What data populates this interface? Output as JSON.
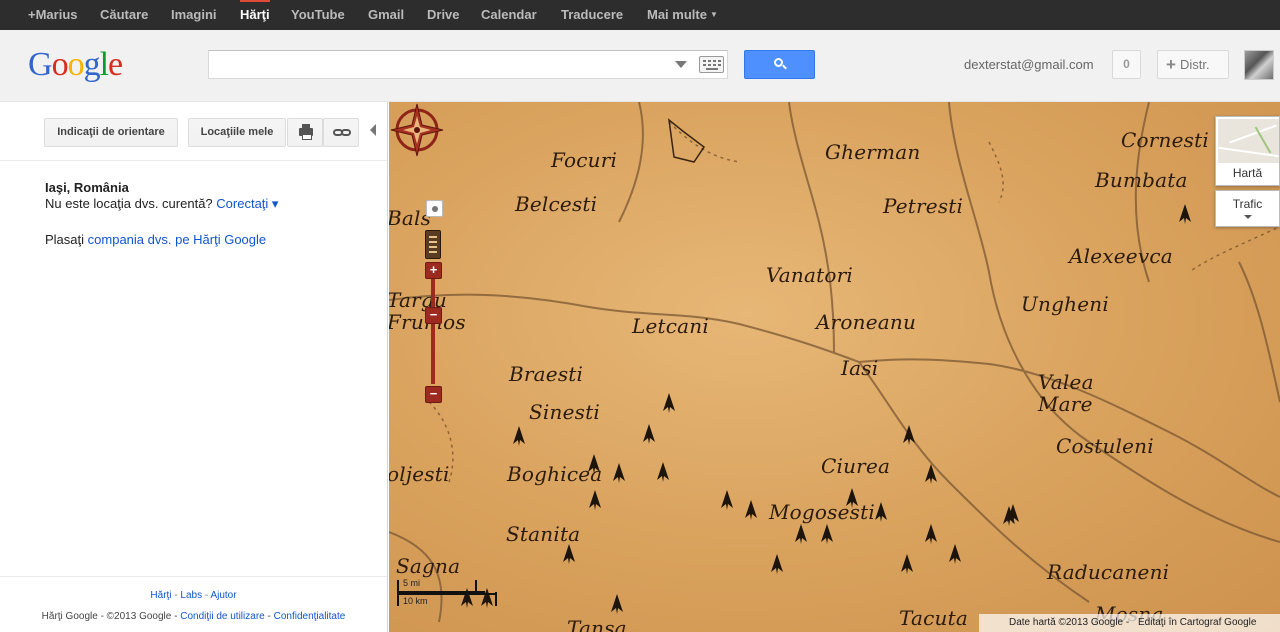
{
  "top_nav": {
    "items": [
      {
        "label": "+Marius",
        "active": false
      },
      {
        "label": "Căutare",
        "active": false
      },
      {
        "label": "Imagini",
        "active": false
      },
      {
        "label": "Hărţi",
        "active": true
      },
      {
        "label": "YouTube",
        "active": false
      },
      {
        "label": "Gmail",
        "active": false
      },
      {
        "label": "Drive",
        "active": false
      },
      {
        "label": "Calendar",
        "active": false
      },
      {
        "label": "Traducere",
        "active": false
      }
    ],
    "more_label": "Mai multe"
  },
  "header": {
    "logo_letters": [
      "G",
      "o",
      "o",
      "g",
      "l",
      "e"
    ],
    "logo_colors": [
      "#3366cc",
      "#d62d20",
      "#f4b400",
      "#3366cc",
      "#069e2d",
      "#d62d20"
    ],
    "search": {
      "value": "",
      "placeholder": ""
    },
    "account_email": "dexterstat@gmail.com",
    "notification_count": "0",
    "share_label": "Distr."
  },
  "panel": {
    "toolbar": {
      "directions_label": "Indicaţii de orientare",
      "my_places_label": "Locaţiile mele",
      "print_icon": "printer-icon",
      "link_icon": "link-icon"
    },
    "location": {
      "title": "Iaşi, România",
      "question": "Nu este locaţia dvs. curentă?",
      "correct_link": "Corectaţi ▾"
    },
    "place_business": {
      "prefix": "Plasaţi",
      "link": "compania dvs. pe Hărţi Google"
    },
    "footer": {
      "links_row1": [
        "Hărţi",
        "Labs",
        "Ajutor"
      ],
      "copyright": "Hărţi Google - ©2013 Google -",
      "terms": "Condiţii de utilizare",
      "privacy": "Confidenţialitate"
    }
  },
  "map": {
    "places": [
      "Focuri",
      "Gherman",
      "Cornesti",
      "Belcesti",
      "Petresti",
      "Bumbata",
      "Bals",
      "Alexeevca",
      "Vanatori",
      "Targu",
      "Frumos",
      "Ungheni",
      "Letcani",
      "Aroneanu",
      "Iasi",
      "Braesti",
      "Valea",
      "Mare",
      "Sinesti",
      "Costuleni",
      "oljesti",
      "Boghicea",
      "Ciurea",
      "Mogosesti",
      "Stanita",
      "Sagna",
      "Raducaneni",
      "Tacuta",
      "Mosna",
      "Tansa"
    ],
    "scale": {
      "miles": "5 mi",
      "km": "10 km"
    },
    "map_type_label": "Hartă",
    "traffic_label": "Trafic",
    "attribution": "Date hartă ©2013 Google -",
    "edit_link": "Editaţi în Cartograf Google",
    "colors": {
      "parchment": "#d8a15c",
      "ink": "#2b1b0e",
      "zoom_red": "#9c2a1e"
    }
  }
}
